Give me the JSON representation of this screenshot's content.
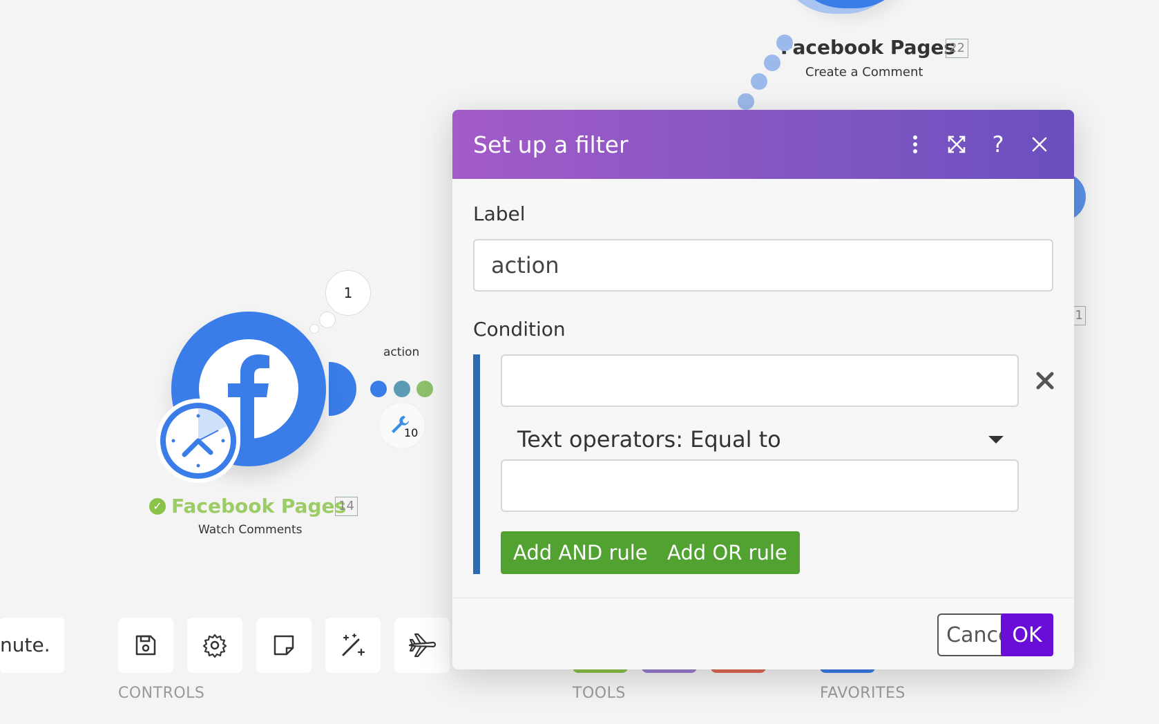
{
  "canvas": {
    "top_module": {
      "title": "Facebook Pages",
      "id": "22",
      "subtitle": "Create a Comment"
    },
    "right_module": {
      "id": "1"
    },
    "main_module": {
      "title": "Facebook Pages",
      "id": "14",
      "subtitle": "Watch Comments",
      "bubble_count": "1",
      "status": "check-icon"
    },
    "filter": {
      "label": "action",
      "operations": "10"
    }
  },
  "toolbar": {
    "status_text": "nute.",
    "controls_label": "CONTROLS",
    "tools_label": "TOOLS",
    "favorites_label": "FAVORITES",
    "buttons": [
      "save-icon",
      "gear-icon",
      "note-icon",
      "magic-wand-icon",
      "airplane-icon"
    ]
  },
  "modal": {
    "title": "Set up a filter",
    "header_icons": [
      "more-vertical-icon",
      "expand-icon",
      "help-icon",
      "close-icon"
    ],
    "label_field": {
      "label": "Label",
      "value": "action"
    },
    "condition": {
      "label": "Condition",
      "first_operand": "",
      "operator": "Text operators: Equal to",
      "second_operand": "",
      "add_and": "Add AND rule",
      "add_or": "Add OR rule"
    },
    "footer": {
      "cancel": "Cancel",
      "ok": "OK"
    }
  },
  "colors": {
    "module_blue": "#3a7de8",
    "success_green": "#9ccc65",
    "header_gradient_start": "#a25bc8",
    "header_gradient_end": "#6a4fbd",
    "rule_button_green": "#52a232",
    "ok_purple": "#6a0dd8"
  }
}
